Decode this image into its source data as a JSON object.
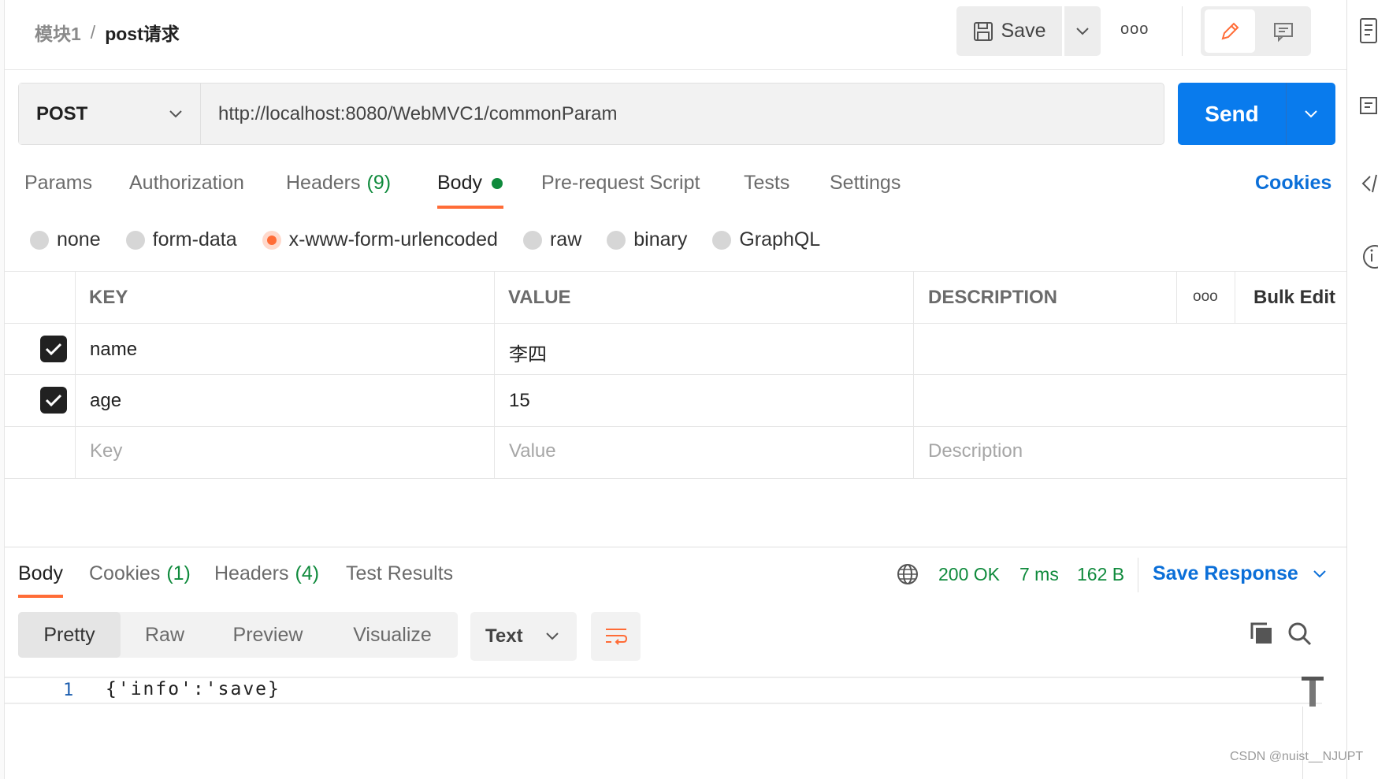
{
  "breadcrumb": {
    "parent": "模块1",
    "separator": "/",
    "current": "post请求"
  },
  "toolbar": {
    "save_label": "Save",
    "more_label": "ooo"
  },
  "request": {
    "method": "POST",
    "url": "http://localhost:8080/WebMVC1/commonParam",
    "send_label": "Send"
  },
  "request_tabs": {
    "params": "Params",
    "authorization": "Authorization",
    "headers": "Headers",
    "headers_count": "(9)",
    "body": "Body",
    "pre_request": "Pre-request Script",
    "tests": "Tests",
    "settings": "Settings",
    "cookies": "Cookies"
  },
  "body_types": {
    "none": "none",
    "form_data": "form-data",
    "urlencoded": "x-www-form-urlencoded",
    "raw": "raw",
    "binary": "binary",
    "graphql": "GraphQL",
    "selected": "x-www-form-urlencoded"
  },
  "table": {
    "headers": {
      "key": "KEY",
      "value": "VALUE",
      "description": "DESCRIPTION",
      "more": "ooo",
      "bulk_edit": "Bulk Edit"
    },
    "rows": [
      {
        "key": "name",
        "value": "李四",
        "description": "",
        "checked": true
      },
      {
        "key": "age",
        "value": "15",
        "description": "",
        "checked": true
      }
    ],
    "placeholders": {
      "key": "Key",
      "value": "Value",
      "description": "Description"
    }
  },
  "response_tabs": {
    "body": "Body",
    "cookies": "Cookies",
    "cookies_count": "(1)",
    "headers": "Headers",
    "headers_count": "(4)",
    "test_results": "Test Results"
  },
  "response_meta": {
    "status": "200 OK",
    "time": "7 ms",
    "size": "162 B",
    "save_response": "Save Response"
  },
  "view_modes": {
    "pretty": "Pretty",
    "raw": "Raw",
    "preview": "Preview",
    "visualize": "Visualize",
    "format": "Text"
  },
  "code": {
    "line_number": "1",
    "content": "{'info':'save}"
  },
  "watermark": "CSDN @nuist__NJUPT",
  "colors": {
    "accent": "#ff6c37",
    "primary": "#0b6fd8",
    "status_ok": "#0f8a3c"
  }
}
